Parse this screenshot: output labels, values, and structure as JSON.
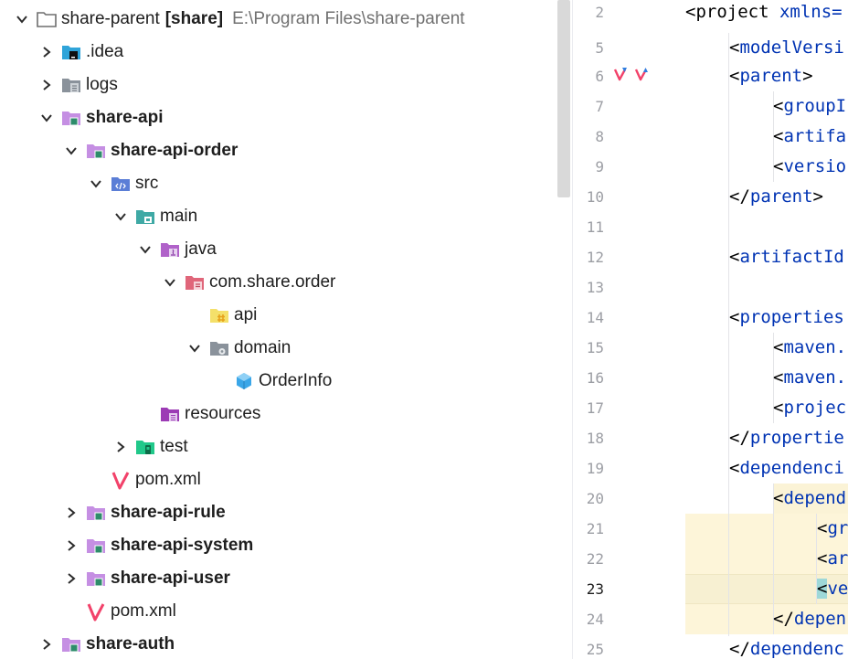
{
  "tree": {
    "root": {
      "name": "share-parent",
      "module": "[share]",
      "path": "E:\\Program Files\\share-parent"
    },
    "idea": ".idea",
    "logs": "logs",
    "share_api": "share-api",
    "share_api_order": "share-api-order",
    "src": "src",
    "main": "main",
    "java": "java",
    "package": "com.share.order",
    "api": "api",
    "domain": "domain",
    "order_info": "OrderInfo",
    "resources": "resources",
    "test": "test",
    "pom_inner": "pom.xml",
    "share_api_rule": "share-api-rule",
    "share_api_system": "share-api-system",
    "share_api_user": "share-api-user",
    "pom_outer": "pom.xml",
    "share_auth": "share-auth"
  },
  "gutter": {
    "numbers": [
      "2",
      "5",
      "6",
      "7",
      "8",
      "9",
      "10",
      "11",
      "12",
      "13",
      "14",
      "15",
      "16",
      "17",
      "18",
      "19",
      "20",
      "21",
      "22",
      "23",
      "24",
      "25"
    ],
    "current_line": "23"
  },
  "code": {
    "l2_tag": "<project",
    "l2_attr": " xmlns=",
    "l5": "<modelVersi",
    "l6": "<parent>",
    "l7": "<groupI",
    "l8": "<artifa",
    "l9": "<versio",
    "l10": "</parent>",
    "l12": "<artifactId",
    "l14": "<properties",
    "l15": "<maven.",
    "l16": "<maven.",
    "l17": "<projec",
    "l18": "</propertie",
    "l19": "<dependenci",
    "l20": "<depend",
    "l21": "<gr",
    "l22": "<ar",
    "l23_bracket": "<",
    "l23_rest": "ve",
    "l24": "</depen",
    "l25": "</dependenc"
  },
  "colors": {
    "tag": "#0033b3",
    "folder_module": "#b07ad8",
    "folder_src": "#5b7ed6",
    "folder_main": "#3fa9a5",
    "folder_java": "#b062c9",
    "folder_package": "#e0667a",
    "maven": "#f2426a",
    "highlight_line": "#fdf5d9",
    "bulb": "#f2b61c"
  },
  "icons": {
    "chevron_right": "chevron-right-icon",
    "chevron_down": "chevron-down-icon",
    "module": "module-folder-icon",
    "idea": "idea-folder-icon",
    "logs": "logs-folder-icon",
    "src": "source-folder-icon",
    "main": "main-folder-icon",
    "java": "java-folder-icon",
    "package": "package-icon",
    "api": "api-package-icon",
    "domain": "domain-package-icon",
    "class": "class-icon",
    "resources": "resources-folder-icon",
    "test": "test-folder-icon",
    "maven": "maven-icon",
    "bulb": "lightbulb-icon",
    "override": "override-marker-icon"
  }
}
